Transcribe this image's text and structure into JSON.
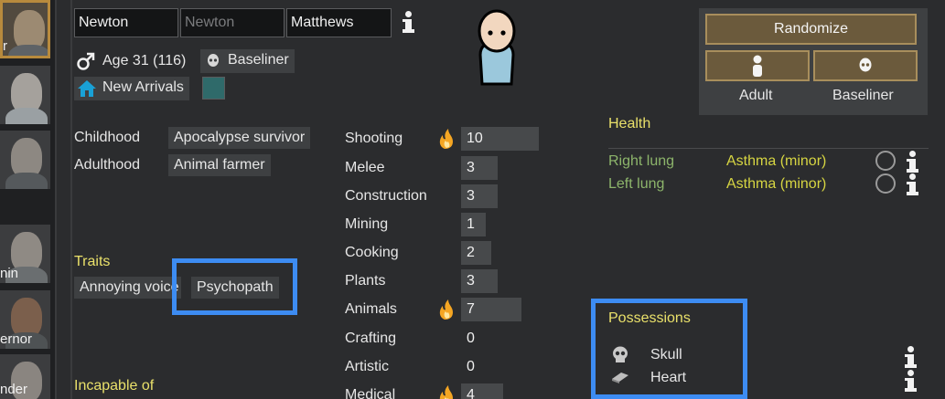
{
  "name": {
    "first": "Newton",
    "nick_placeholder": "Newton",
    "last": "Matthews"
  },
  "pawn": {
    "age": "Age 31 (116)",
    "xenotype": "Baseliner",
    "faction": "New Arrivals"
  },
  "buttons": {
    "randomize": "Randomize",
    "adult": "Adult",
    "baseliner": "Baseliner"
  },
  "colonists": [
    {
      "label": "r"
    },
    {
      "label": ""
    },
    {
      "label": ""
    },
    {
      "label": "nin"
    },
    {
      "label": "ernor"
    },
    {
      "label": "nder"
    }
  ],
  "backstory": {
    "childhood_label": "Childhood",
    "childhood": "Apocalypse survivor",
    "adulthood_label": "Adulthood",
    "adulthood": "Animal farmer"
  },
  "traits": {
    "title": "Traits",
    "items": [
      "Annoying voice",
      "Psychopath"
    ]
  },
  "incapable": {
    "title": "Incapable of"
  },
  "skills": [
    {
      "name": "Shooting",
      "level": "10",
      "passion": true,
      "fill": 0.5
    },
    {
      "name": "Melee",
      "level": "3",
      "passion": false,
      "fill": 0.15
    },
    {
      "name": "Construction",
      "level": "3",
      "passion": false,
      "fill": 0.15
    },
    {
      "name": "Mining",
      "level": "1",
      "passion": false,
      "fill": 0.05
    },
    {
      "name": "Cooking",
      "level": "2",
      "passion": false,
      "fill": 0.1
    },
    {
      "name": "Plants",
      "level": "3",
      "passion": false,
      "fill": 0.15
    },
    {
      "name": "Animals",
      "level": "7",
      "passion": true,
      "fill": 0.35
    },
    {
      "name": "Crafting",
      "level": "0",
      "passion": false,
      "fill": 0
    },
    {
      "name": "Artistic",
      "level": "0",
      "passion": false,
      "fill": 0
    },
    {
      "name": "Medical",
      "level": "4",
      "passion": true,
      "fill": 0.2
    }
  ],
  "health": {
    "title": "Health",
    "rows": [
      {
        "part": "Right lung",
        "condition": "Asthma (minor)"
      },
      {
        "part": "Left lung",
        "condition": "Asthma (minor)"
      }
    ]
  },
  "possessions": {
    "title": "Possessions",
    "items": [
      {
        "name": "Skull",
        "icon": "skull-icon"
      },
      {
        "name": "Heart",
        "icon": "heart-organ-icon"
      }
    ]
  },
  "colors": {
    "accent_gold": "#b88a3d",
    "highlight_blue": "#3d8cf2",
    "section_yellow": "#e9e06a",
    "health_green": "#8db56b",
    "passion_flame": "#f5a623"
  }
}
